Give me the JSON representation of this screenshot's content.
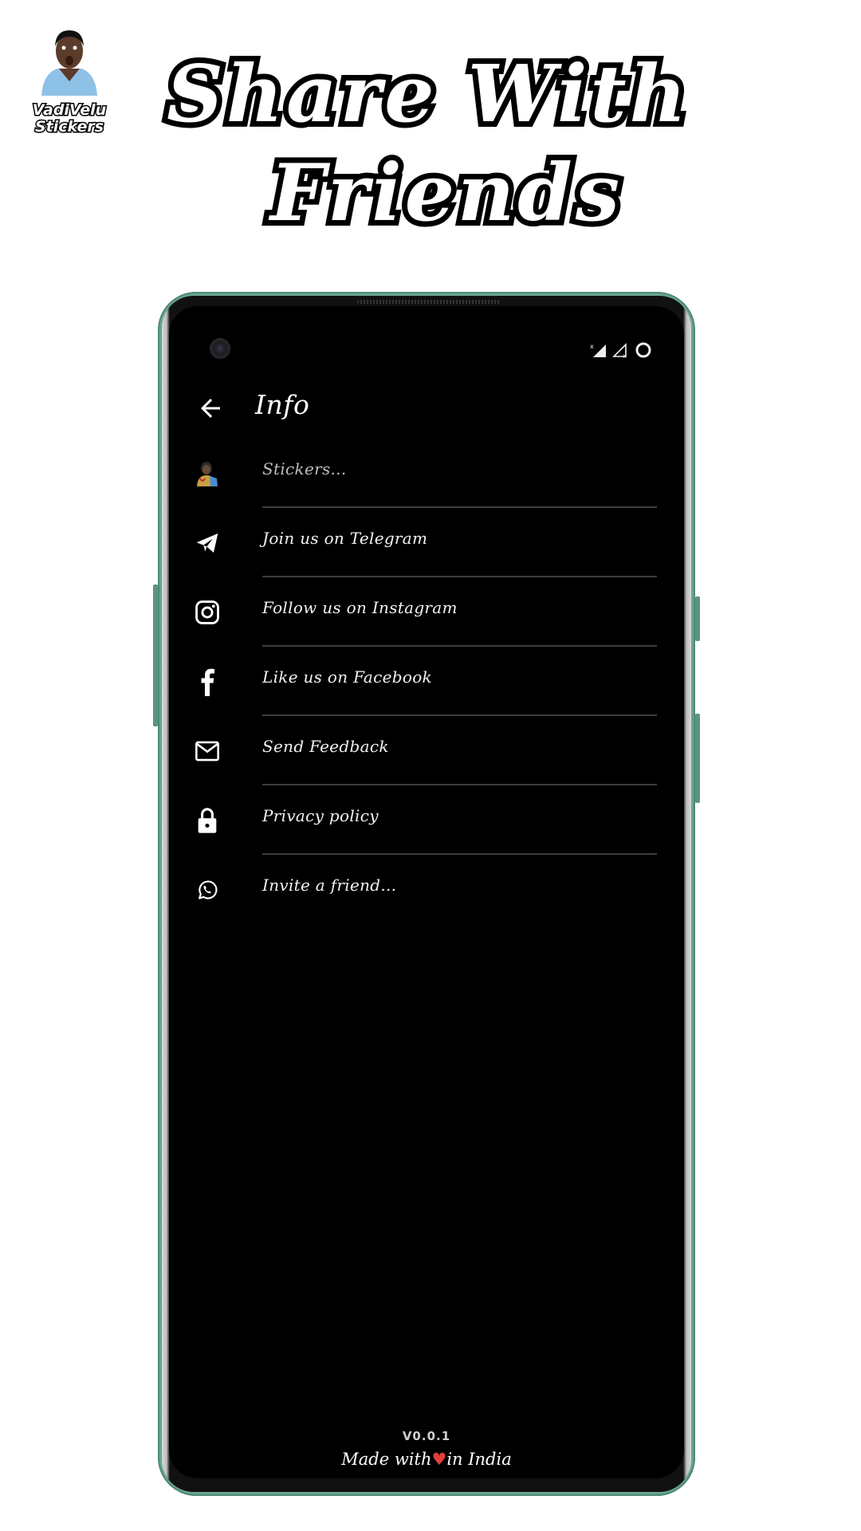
{
  "promo": {
    "logo_line1": "VadiVelu",
    "logo_line2": "Stickers",
    "headline_line1": "Share With",
    "headline_line2": "Friends"
  },
  "status_bar": {
    "icons": [
      "signal-no-sim-icon",
      "signal-empty-icon",
      "battery-circle-icon"
    ]
  },
  "app": {
    "title": "Info",
    "back_icon": "arrow-left-icon",
    "items": [
      {
        "label": "Stickers...",
        "icon": "sticker-avatar-icon"
      },
      {
        "label": "Join us on Telegram",
        "icon": "telegram-icon"
      },
      {
        "label": "Follow us on Instagram",
        "icon": "instagram-icon"
      },
      {
        "label": "Like us on Facebook",
        "icon": "facebook-icon"
      },
      {
        "label": "Send Feedback",
        "icon": "mail-icon"
      },
      {
        "label": "Privacy policy",
        "icon": "lock-icon"
      },
      {
        "label": "Invite a friend...",
        "icon": "whatsapp-icon"
      }
    ],
    "footer": {
      "version": "V0.0.1",
      "made_prefix": "Made with",
      "heart": "♥",
      "made_suffix": "in India"
    }
  },
  "colors": {
    "frame": "#6aa592",
    "screen": "#000000",
    "divider": "#3c3c3c",
    "heart": "#e0403a"
  }
}
